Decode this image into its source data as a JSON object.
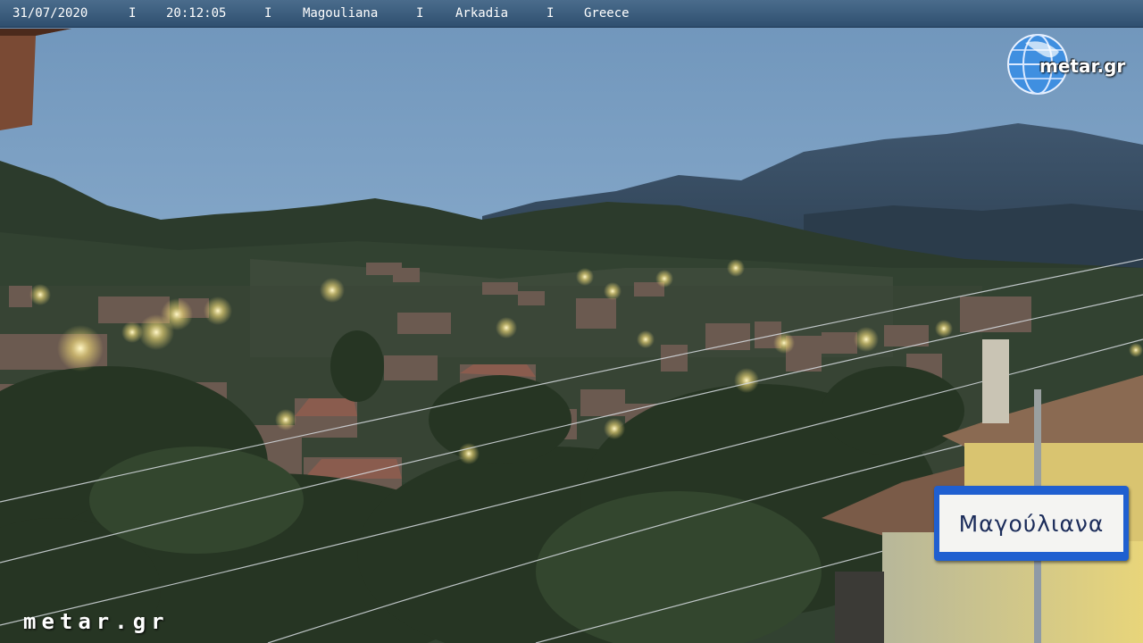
{
  "overlay": {
    "date": "31/07/2020",
    "time": "20:12:05",
    "location": "Magouliana",
    "region": "Arkadia",
    "country": "Greece",
    "separator": "I"
  },
  "logo": {
    "text": "metar.gr",
    "icon": "globe-icon"
  },
  "watermark": {
    "text": "metar.gr"
  },
  "road_sign": {
    "text": "Μαγούλιανα",
    "color": "#1f5fd0"
  },
  "scene": {
    "sky_color": "#86a8c8",
    "village_light_color": "#ffe9a0"
  }
}
